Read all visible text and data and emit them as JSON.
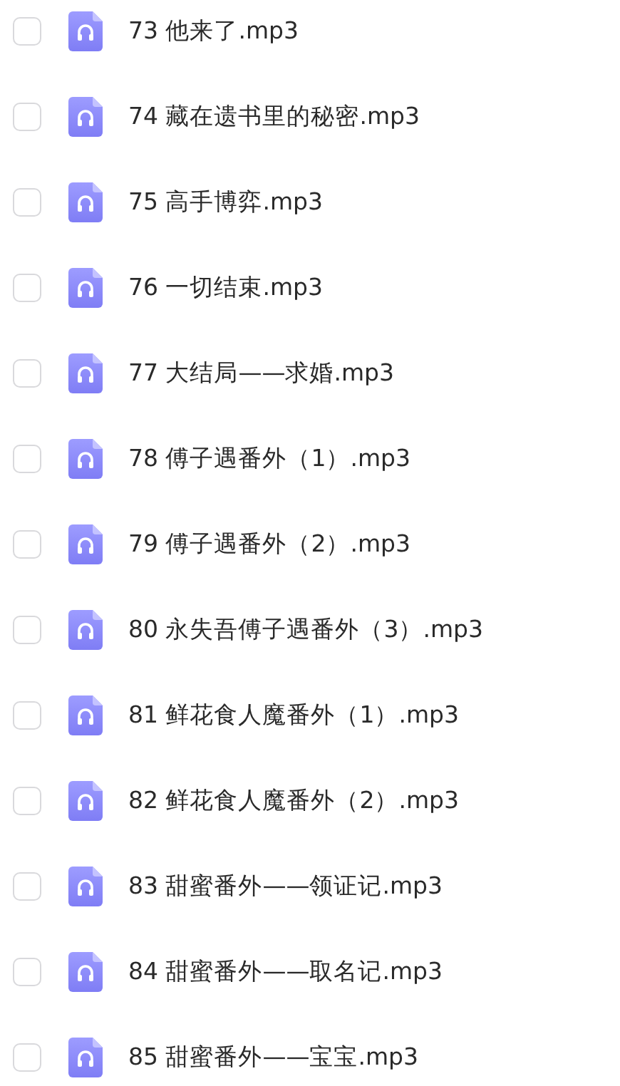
{
  "files": [
    {
      "name": "73 他来了.mp3",
      "checked": false
    },
    {
      "name": "74 藏在遗书里的秘密.mp3",
      "checked": false
    },
    {
      "name": "75 高手博弈.mp3",
      "checked": false
    },
    {
      "name": "76 一切结束.mp3",
      "checked": false
    },
    {
      "name": "77 大结局——求婚.mp3",
      "checked": false
    },
    {
      "name": "78 傅子遇番外（1）.mp3",
      "checked": false
    },
    {
      "name": "79 傅子遇番外（2）.mp3",
      "checked": false
    },
    {
      "name": "80 永失吾傅子遇番外（3）.mp3",
      "checked": false
    },
    {
      "name": "81 鲜花食人魔番外（1）.mp3",
      "checked": false
    },
    {
      "name": "82 鲜花食人魔番外（2）.mp3",
      "checked": false
    },
    {
      "name": "83 甜蜜番外——领证记.mp3",
      "checked": false
    },
    {
      "name": "84 甜蜜番外——取名记.mp3",
      "checked": false
    },
    {
      "name": "85 甜蜜番外——宝宝.mp3",
      "checked": false
    }
  ]
}
